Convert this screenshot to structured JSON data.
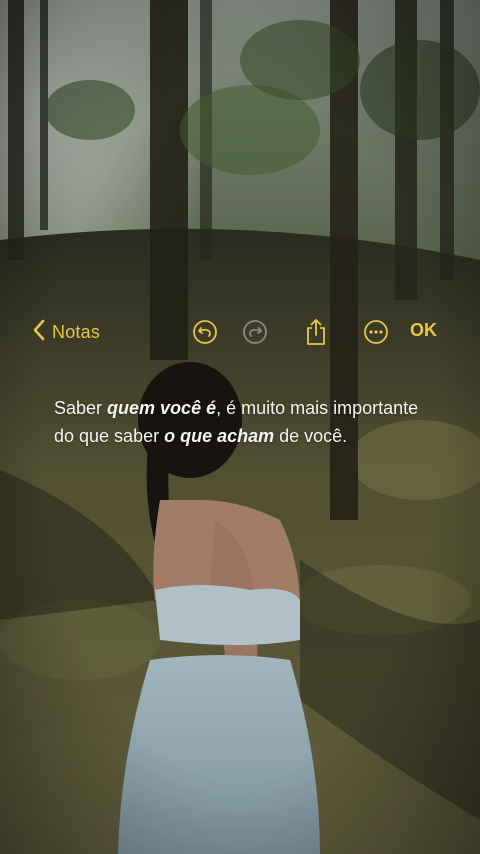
{
  "toolbar": {
    "back_label": "Notas",
    "done_label": "OK",
    "icons": [
      "chevron-left-icon",
      "undo-icon",
      "redo-icon",
      "share-icon",
      "more-icon"
    ]
  },
  "note": {
    "segments": [
      {
        "text": "Saber ",
        "emphasis": false
      },
      {
        "text": "quem você é",
        "emphasis": true
      },
      {
        "text": ", é muito mais importante do que saber ",
        "emphasis": false
      },
      {
        "text": "o que acham",
        "emphasis": true
      },
      {
        "text": " de você.",
        "emphasis": false
      }
    ]
  },
  "colors": {
    "accent": "#e8c64a",
    "text": "#f4f4f2",
    "icon_disabled": "#8a8a80"
  }
}
